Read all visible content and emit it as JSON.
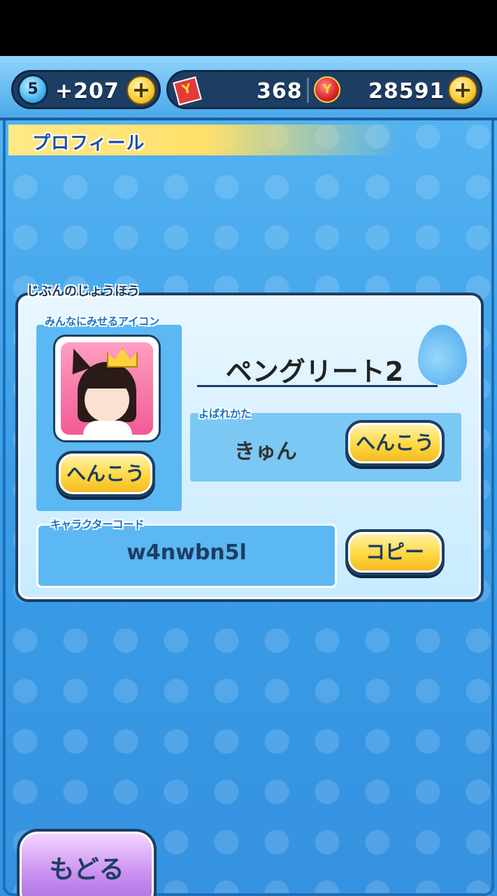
{
  "topbar": {
    "level": "5",
    "stamina_gain": "+207",
    "tickets": "368",
    "coins": "28591",
    "ticket_icon_letter": "Y",
    "coin_icon_letter": "Y"
  },
  "header": {
    "title": "プロフィール"
  },
  "profile_panel": {
    "section_label": "じぶんのじょうほう",
    "icon_label": "みんなにみせるアイコン",
    "icon_change_button": "へんこう",
    "player_name": "ペングリート2",
    "call_name_label": "よばれかた",
    "call_name_value": "きゅん",
    "call_name_change_button": "へんこう",
    "character_code_label": "キャラクターコード",
    "character_code_value": "w4nwbn5l",
    "copy_button": "コピー"
  },
  "footer": {
    "back_button": "もどる"
  },
  "colors": {
    "background_blue": "#3a9fe8",
    "panel_border": "#1d3e63",
    "button_yellow": "#ffd840",
    "button_purple": "#c98ff0",
    "header_yellow": "#ffe06a"
  }
}
